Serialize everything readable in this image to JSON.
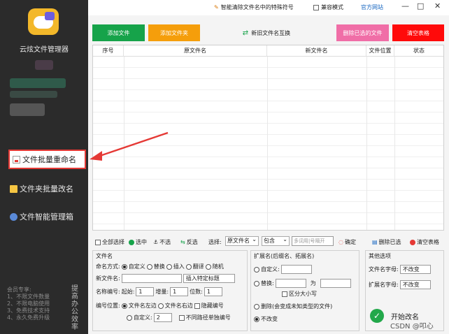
{
  "sidebar": {
    "app_name": "云炫文件管理器",
    "nav": [
      {
        "label": "文件批量重命名",
        "active": true
      },
      {
        "label": "文件夹批量改名",
        "active": false
      },
      {
        "label": "文件智能管理箱",
        "active": false
      }
    ],
    "promo": [
      "会员专享:",
      "1、不限文件数量",
      "2、不限电脑使用",
      "3、免费技术支持",
      "4、永久免费升级"
    ],
    "promo_vertical": "提高办公效率"
  },
  "topbar": {
    "tip": "智能清除文件名中的特殊符号",
    "compat_mode": "兼容模式",
    "website": "官方网站",
    "min": "—",
    "max": "□",
    "close": "✕"
  },
  "buttons": {
    "add_file": "添加文件",
    "add_folder": "添加文件夹",
    "swap_names": "新旧文件名互换",
    "delete_selected": "删除已选的文件",
    "clear_table": "清空表格"
  },
  "table": {
    "columns": [
      "序号",
      "原文件名",
      "新文件名",
      "文件位置",
      "状态"
    ],
    "rows": []
  },
  "toolbar2": {
    "select_all": "全部选择",
    "select": "选中",
    "deselect": "不选",
    "invert": "反选",
    "choose_label": "选择:",
    "field_select": "原文件名",
    "match_select": "包含",
    "keyword_placeholder": "多词用|号隔开",
    "confirm": "确定",
    "delete_selected": "删除已选",
    "clear_table": "清空表格"
  },
  "file_panel": {
    "title": "文件名",
    "naming_mode_label": "命名方式:",
    "modes": [
      "自定义",
      "替换",
      "插入",
      "翻译",
      "随机"
    ],
    "new_name_label": "新文件名:",
    "insert_select": "插入特定标题",
    "numbering_label": "名称编号:",
    "start_label": "起始:",
    "start_value": "1",
    "step_label": "增量:",
    "step_value": "1",
    "digits_label": "位数:",
    "digits_value": "1",
    "position_label": "编号位置:",
    "pos_left": "文件名左边",
    "pos_right": "文件名右边",
    "hide_number": "隐藏编号",
    "custom_label": "自定义:",
    "custom_value": "2",
    "per_path": "不同路径单独编号"
  },
  "ext_panel": {
    "title": "扩展名(后缀名、拓展名)",
    "custom": "自定义:",
    "replace": "替换:",
    "to": "为",
    "case": "区分大小写",
    "delete": "删除(会变成未知类型的文件)",
    "unchanged": "不改变"
  },
  "other_panel": {
    "title": "其他选项",
    "filename_case_label": "文件名字母:",
    "filename_case_value": "不改变",
    "ext_case_label": "扩展名字母:",
    "ext_case_value": "不改变",
    "start": "开始改名"
  },
  "watermark": "CSDN @叩心"
}
